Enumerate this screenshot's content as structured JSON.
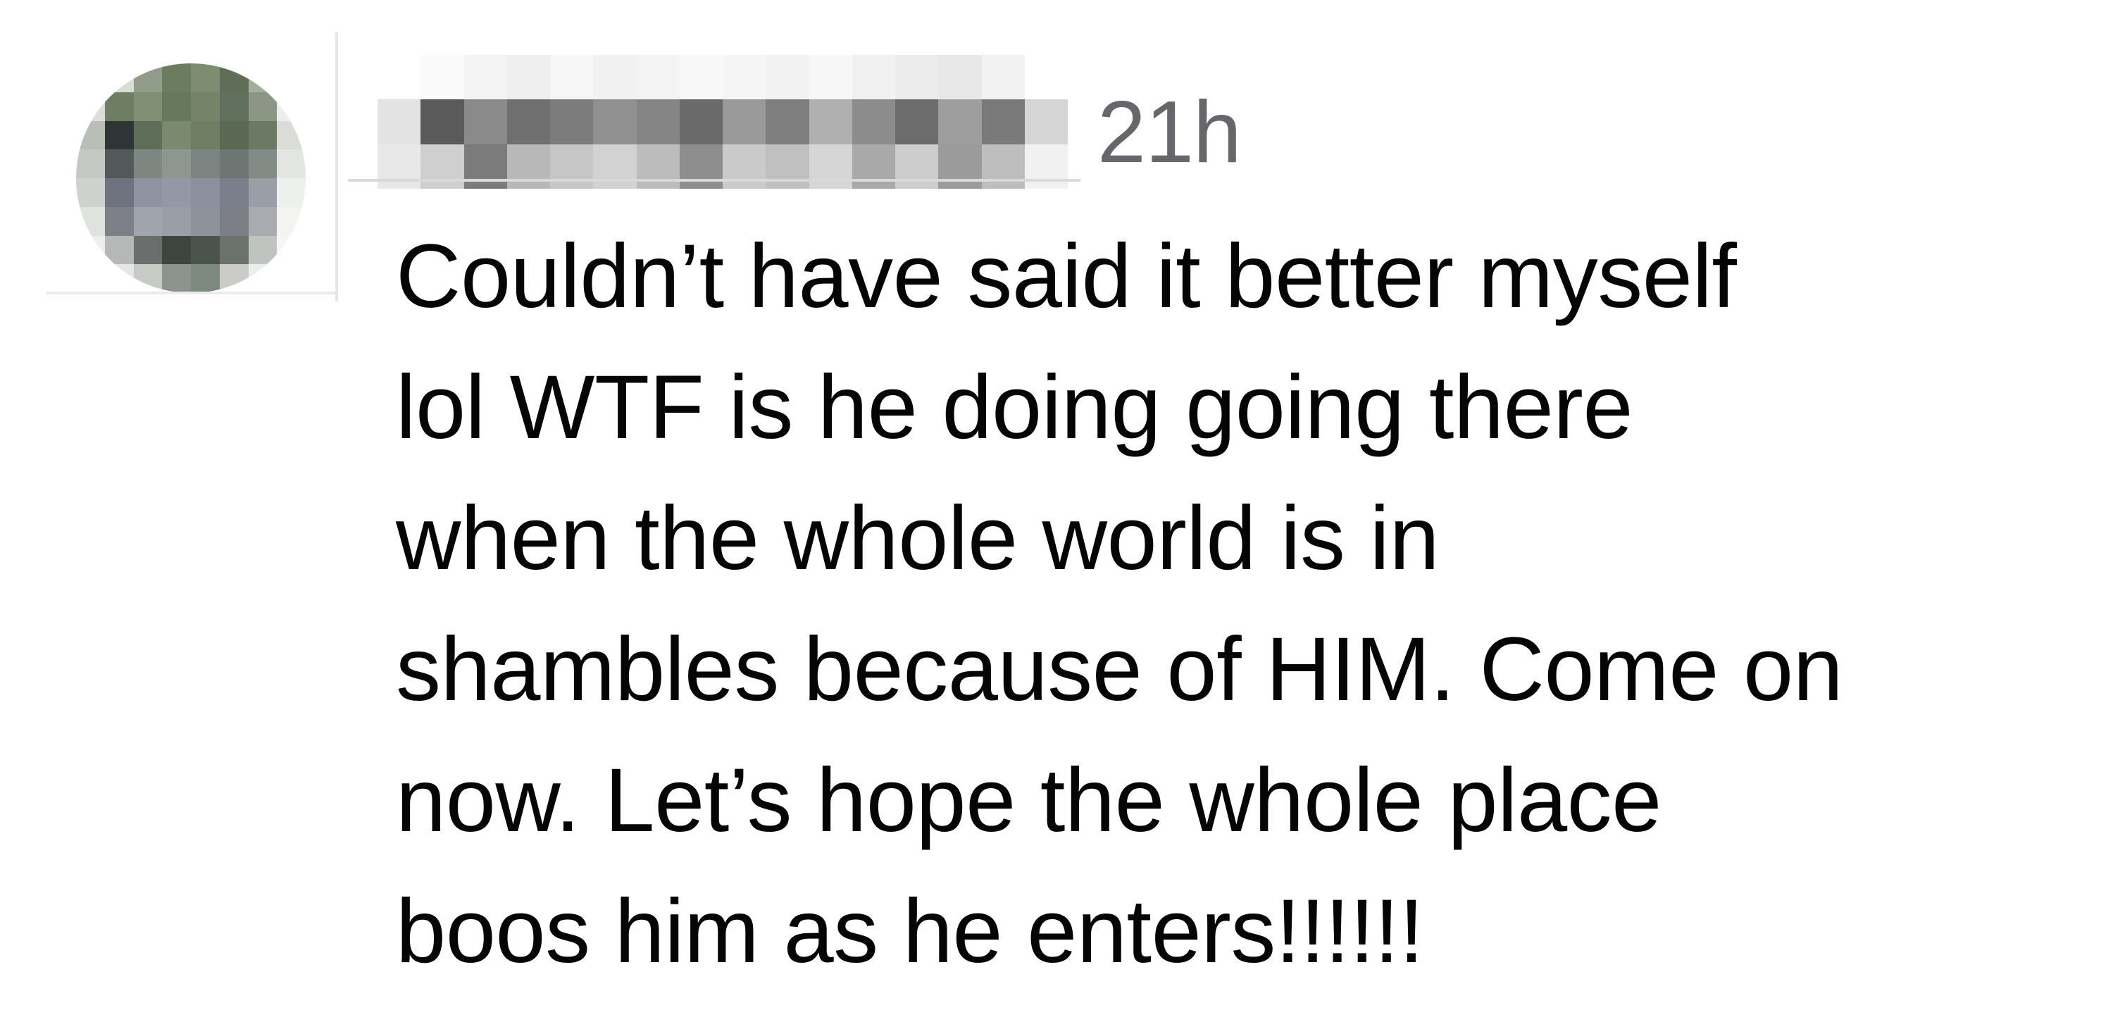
{
  "comment": {
    "username": "",
    "timestamp": "21h",
    "text_lines": [
      "Couldn’t have said it better myself",
      "lol WTF is he doing going there",
      "when the whole world is in",
      "shambles because of HIM. Come on",
      "now. Let’s hope the whole place",
      "boos him as he enters!!!!!!"
    ]
  },
  "colors": {
    "text": "#050505",
    "timestamp": "#65676b",
    "background": "#ffffff"
  },
  "icons": {
    "avatar": "user-avatar-pixelated",
    "username": "redacted-username"
  }
}
